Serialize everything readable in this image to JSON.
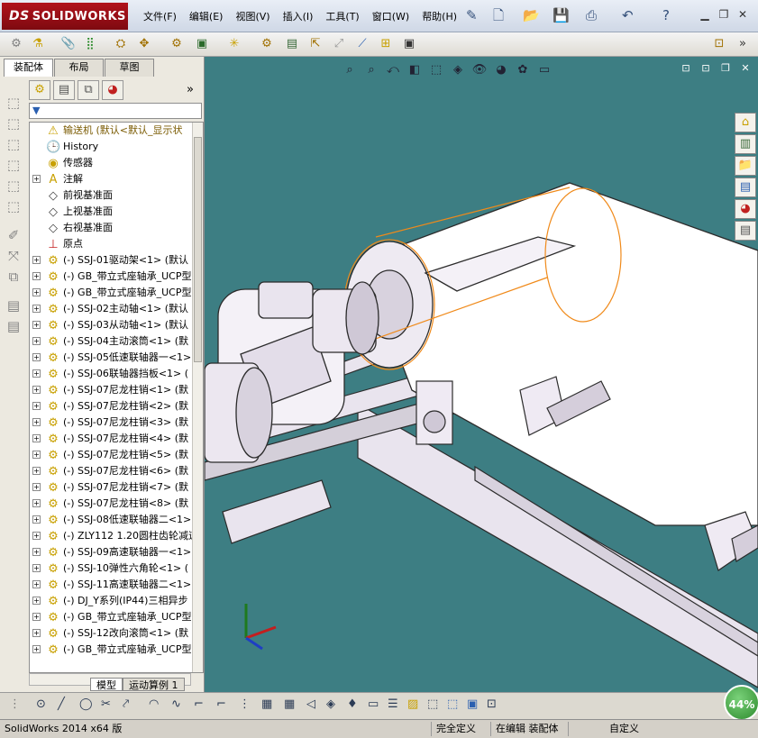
{
  "app": {
    "logo_prefix": "DS",
    "logo_text": "SOLIDWORKS"
  },
  "menu": [
    "文件(F)",
    "编辑(E)",
    "视图(V)",
    "插入(I)",
    "工具(T)",
    "窗口(W)",
    "帮助(H)"
  ],
  "tabs": [
    "装配体",
    "布局",
    "草图"
  ],
  "tree": {
    "filter_glyph": "▼",
    "root": "输送机 (默认<默认_显示状",
    "items": [
      {
        "label": "History",
        "icon": "history-icon",
        "expand": false
      },
      {
        "label": "传感器",
        "icon": "sensor-icon",
        "expand": false
      },
      {
        "label": "注解",
        "icon": "annotation-icon",
        "expand": true
      },
      {
        "label": "前视基准面",
        "icon": "plane-icon",
        "expand": false
      },
      {
        "label": "上视基准面",
        "icon": "plane-icon",
        "expand": false
      },
      {
        "label": "右视基准面",
        "icon": "plane-icon",
        "expand": false
      },
      {
        "label": "原点",
        "icon": "origin-icon",
        "expand": false
      },
      {
        "label": "(-) SSJ-01驱动架<1> (默认",
        "icon": "part-icon",
        "expand": true
      },
      {
        "label": "(-) GB_带立式座轴承_UCP型",
        "icon": "part-icon",
        "expand": true
      },
      {
        "label": "(-) GB_带立式座轴承_UCP型",
        "icon": "part-icon",
        "expand": true
      },
      {
        "label": "(-) SSJ-02主动轴<1> (默认",
        "icon": "part-icon",
        "expand": true
      },
      {
        "label": "(-) SSJ-03从动轴<1> (默认",
        "icon": "part-icon",
        "expand": true
      },
      {
        "label": "(-) SSJ-04主动滚筒<1> (默",
        "icon": "part-icon",
        "expand": true
      },
      {
        "label": "(-) SSJ-05低速联轴器一<1>",
        "icon": "part-icon",
        "expand": true
      },
      {
        "label": "(-) SSJ-06联轴器挡板<1> (",
        "icon": "part-icon",
        "expand": true
      },
      {
        "label": "(-) SSJ-07尼龙柱销<1> (默",
        "icon": "part-icon",
        "expand": true
      },
      {
        "label": "(-) SSJ-07尼龙柱销<2> (默",
        "icon": "part-icon",
        "expand": true
      },
      {
        "label": "(-) SSJ-07尼龙柱销<3> (默",
        "icon": "part-icon",
        "expand": true
      },
      {
        "label": "(-) SSJ-07尼龙柱销<4> (默",
        "icon": "part-icon",
        "expand": true
      },
      {
        "label": "(-) SSJ-07尼龙柱销<5> (默",
        "icon": "part-icon",
        "expand": true
      },
      {
        "label": "(-) SSJ-07尼龙柱销<6> (默",
        "icon": "part-icon",
        "expand": true
      },
      {
        "label": "(-) SSJ-07尼龙柱销<7> (默",
        "icon": "part-icon",
        "expand": true
      },
      {
        "label": "(-) SSJ-07尼龙柱销<8> (默",
        "icon": "part-icon",
        "expand": true
      },
      {
        "label": "(-) SSJ-08低速联轴器二<1>",
        "icon": "part-icon",
        "expand": true
      },
      {
        "label": "(-) ZLY112 1.20圆柱齿轮减速",
        "icon": "part-icon",
        "expand": true
      },
      {
        "label": "(-) SSJ-09高速联轴器一<1>",
        "icon": "part-icon",
        "expand": true
      },
      {
        "label": "(-) SSJ-10弹性六角轮<1> (",
        "icon": "part-icon",
        "expand": true
      },
      {
        "label": "(-) SSJ-11高速联轴器二<1>",
        "icon": "part-icon",
        "expand": true
      },
      {
        "label": "(-) DJ_Y系列(IP44)三相异步",
        "icon": "part-icon",
        "expand": true
      },
      {
        "label": "(-) GB_带立式座轴承_UCP型",
        "icon": "part-icon",
        "expand": true
      },
      {
        "label": "(-) SSJ-12改向滚筒<1> (默",
        "icon": "part-icon",
        "expand": true
      },
      {
        "label": "(-) GB_带立式座轴承_UCP型",
        "icon": "part-icon",
        "expand": true
      }
    ]
  },
  "bottom_tabs": [
    "模型",
    "运动算例 1"
  ],
  "zoom_badge": "44%",
  "status": {
    "version": "SolidWorks 2014 x64 版",
    "definition": "完全定义",
    "mode": "在编辑 装配体",
    "units": "自定义"
  },
  "colors": {
    "viewport_bg": "#3d7e83",
    "accent": "#b1121c",
    "selection_outline": "#f08a1a"
  }
}
